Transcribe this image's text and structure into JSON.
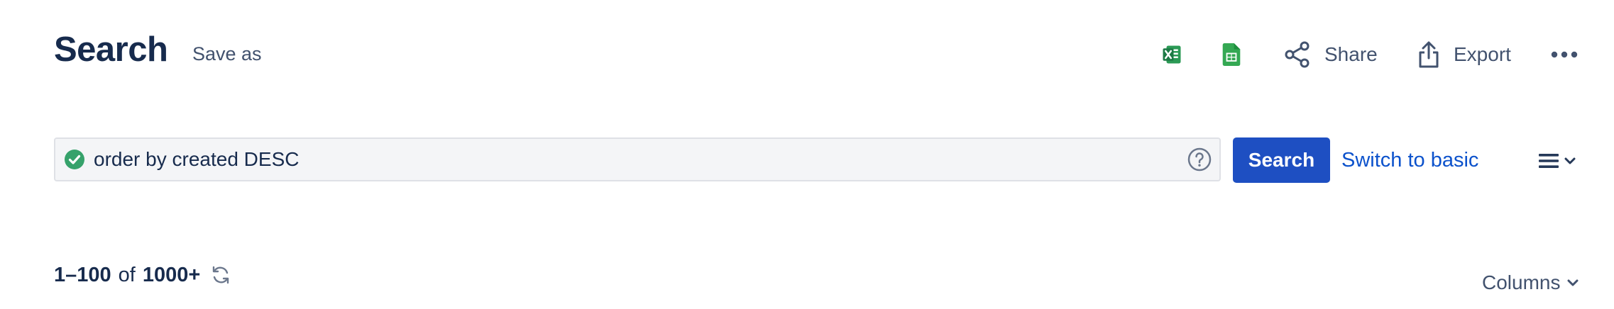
{
  "header": {
    "title": "Search",
    "save_as_label": "Save as",
    "actions": {
      "excel_icon": "excel-icon",
      "sheets_icon": "google-sheets-icon",
      "share_label": "Share",
      "export_label": "Export"
    }
  },
  "search": {
    "query": "order by created DESC",
    "valid_icon": "check-circle-icon",
    "help_icon": "question-circle-icon",
    "button_label": "Search",
    "switch_label": "Switch to basic"
  },
  "results": {
    "range": "1–100",
    "of_label": "of",
    "total": "1000+",
    "columns_label": "Columns"
  },
  "colors": {
    "primary": "#1e4fc2",
    "link": "#0c52cc",
    "heading": "#172b4d",
    "subtle": "#42526e",
    "success": "#36a26b",
    "excel_green": "#1d7a45",
    "sheets_green": "#34a853"
  }
}
